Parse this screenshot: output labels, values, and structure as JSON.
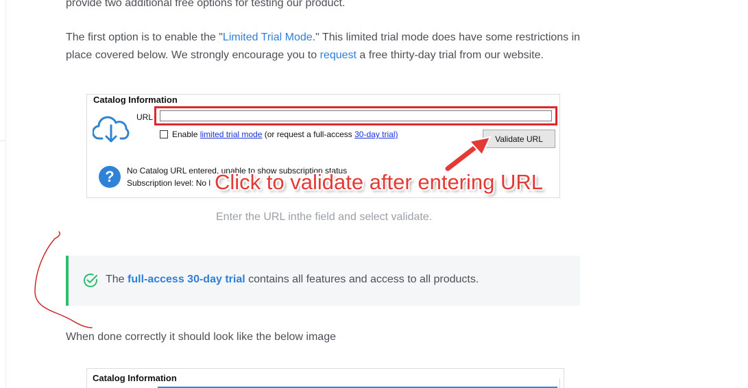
{
  "article": {
    "intro_tail": "provide two additional free options for testing our product.",
    "option_para": {
      "part1": "The first option is to enable the \"",
      "link1": "Limited Trial Mode",
      "part2": ".\" This limited trial mode does have some restrictions in place covered below. We strongly encourage you to ",
      "link2": "request",
      "part3": " a free thirty-day trial from our website."
    },
    "figure1": {
      "legend": "Catalog Information",
      "url_label": "URL",
      "url_value": "",
      "checkbox_prefix": "Enable ",
      "limited_link": "limited trial mode",
      "checkbox_mid": " (or request a full-access ",
      "trial_link": "30-day trial)",
      "validate_button": "Validate URL",
      "status_line1": "No Catalog URL entered, unable to show subscription status",
      "status_line2": "Subscription level: No l",
      "callout": "Click to validate after entering URL",
      "icons": {
        "cloud": "cloud-download-icon",
        "question": "question-icon",
        "arrow": "red-arrow-icon"
      }
    },
    "caption": "Enter the URL inthe field and select validate.",
    "tip": {
      "prefix": "The ",
      "link": "full-access 30-day trial",
      "suffix": " contains all features and access to all products.",
      "icon": "check-circle-icon",
      "accent": "#2dbd6e"
    },
    "done_text": "When done correctly it should look like the below image",
    "figure2": {
      "legend": "Catalog Information"
    }
  },
  "colors": {
    "link": "#2f7fd8",
    "callout": "#e53935",
    "highlight": "#e0272c"
  }
}
